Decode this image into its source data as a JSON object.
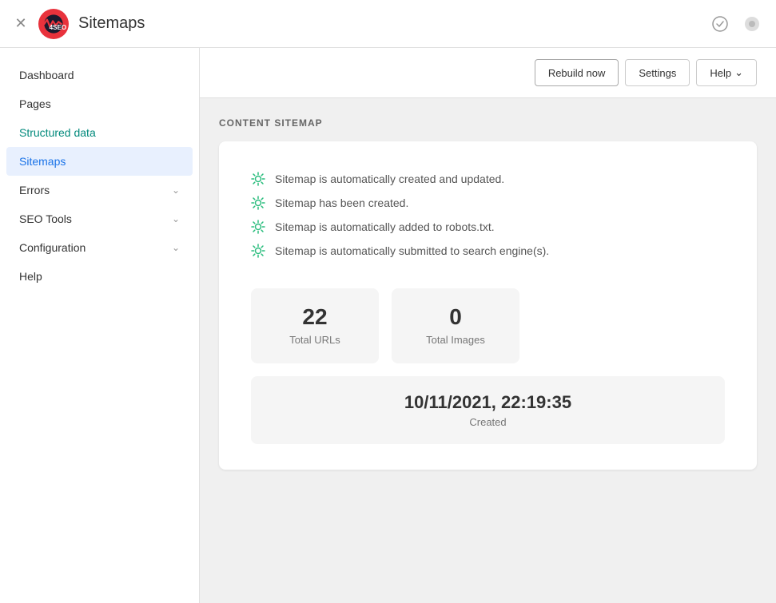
{
  "header": {
    "title": "Sitemaps",
    "logo_text": "4SEO"
  },
  "sidebar": {
    "items": [
      {
        "label": "Dashboard",
        "active": false,
        "expandable": false,
        "teal": false
      },
      {
        "label": "Pages",
        "active": false,
        "expandable": false,
        "teal": false
      },
      {
        "label": "Structured data",
        "active": false,
        "expandable": false,
        "teal": true
      },
      {
        "label": "Sitemaps",
        "active": true,
        "expandable": false,
        "teal": false
      },
      {
        "label": "Errors",
        "active": false,
        "expandable": true,
        "teal": false
      },
      {
        "label": "SEO Tools",
        "active": false,
        "expandable": true,
        "teal": false
      },
      {
        "label": "Configuration",
        "active": false,
        "expandable": true,
        "teal": false
      },
      {
        "label": "Help",
        "active": false,
        "expandable": false,
        "teal": false
      }
    ]
  },
  "toolbar": {
    "rebuild_label": "Rebuild now",
    "settings_label": "Settings",
    "help_label": "Help"
  },
  "content": {
    "section_title": "CONTENT SITEMAP",
    "status_items": [
      "Sitemap is automatically created and updated.",
      "Sitemap has been created.",
      "Sitemap is automatically added to robots.txt.",
      "Sitemap is automatically submitted to search engine(s)."
    ],
    "stats": [
      {
        "number": "22",
        "label": "Total URLs"
      },
      {
        "number": "0",
        "label": "Total Images"
      }
    ],
    "date": {
      "value": "10/11/2021, 22:19:35",
      "label": "Created"
    }
  }
}
